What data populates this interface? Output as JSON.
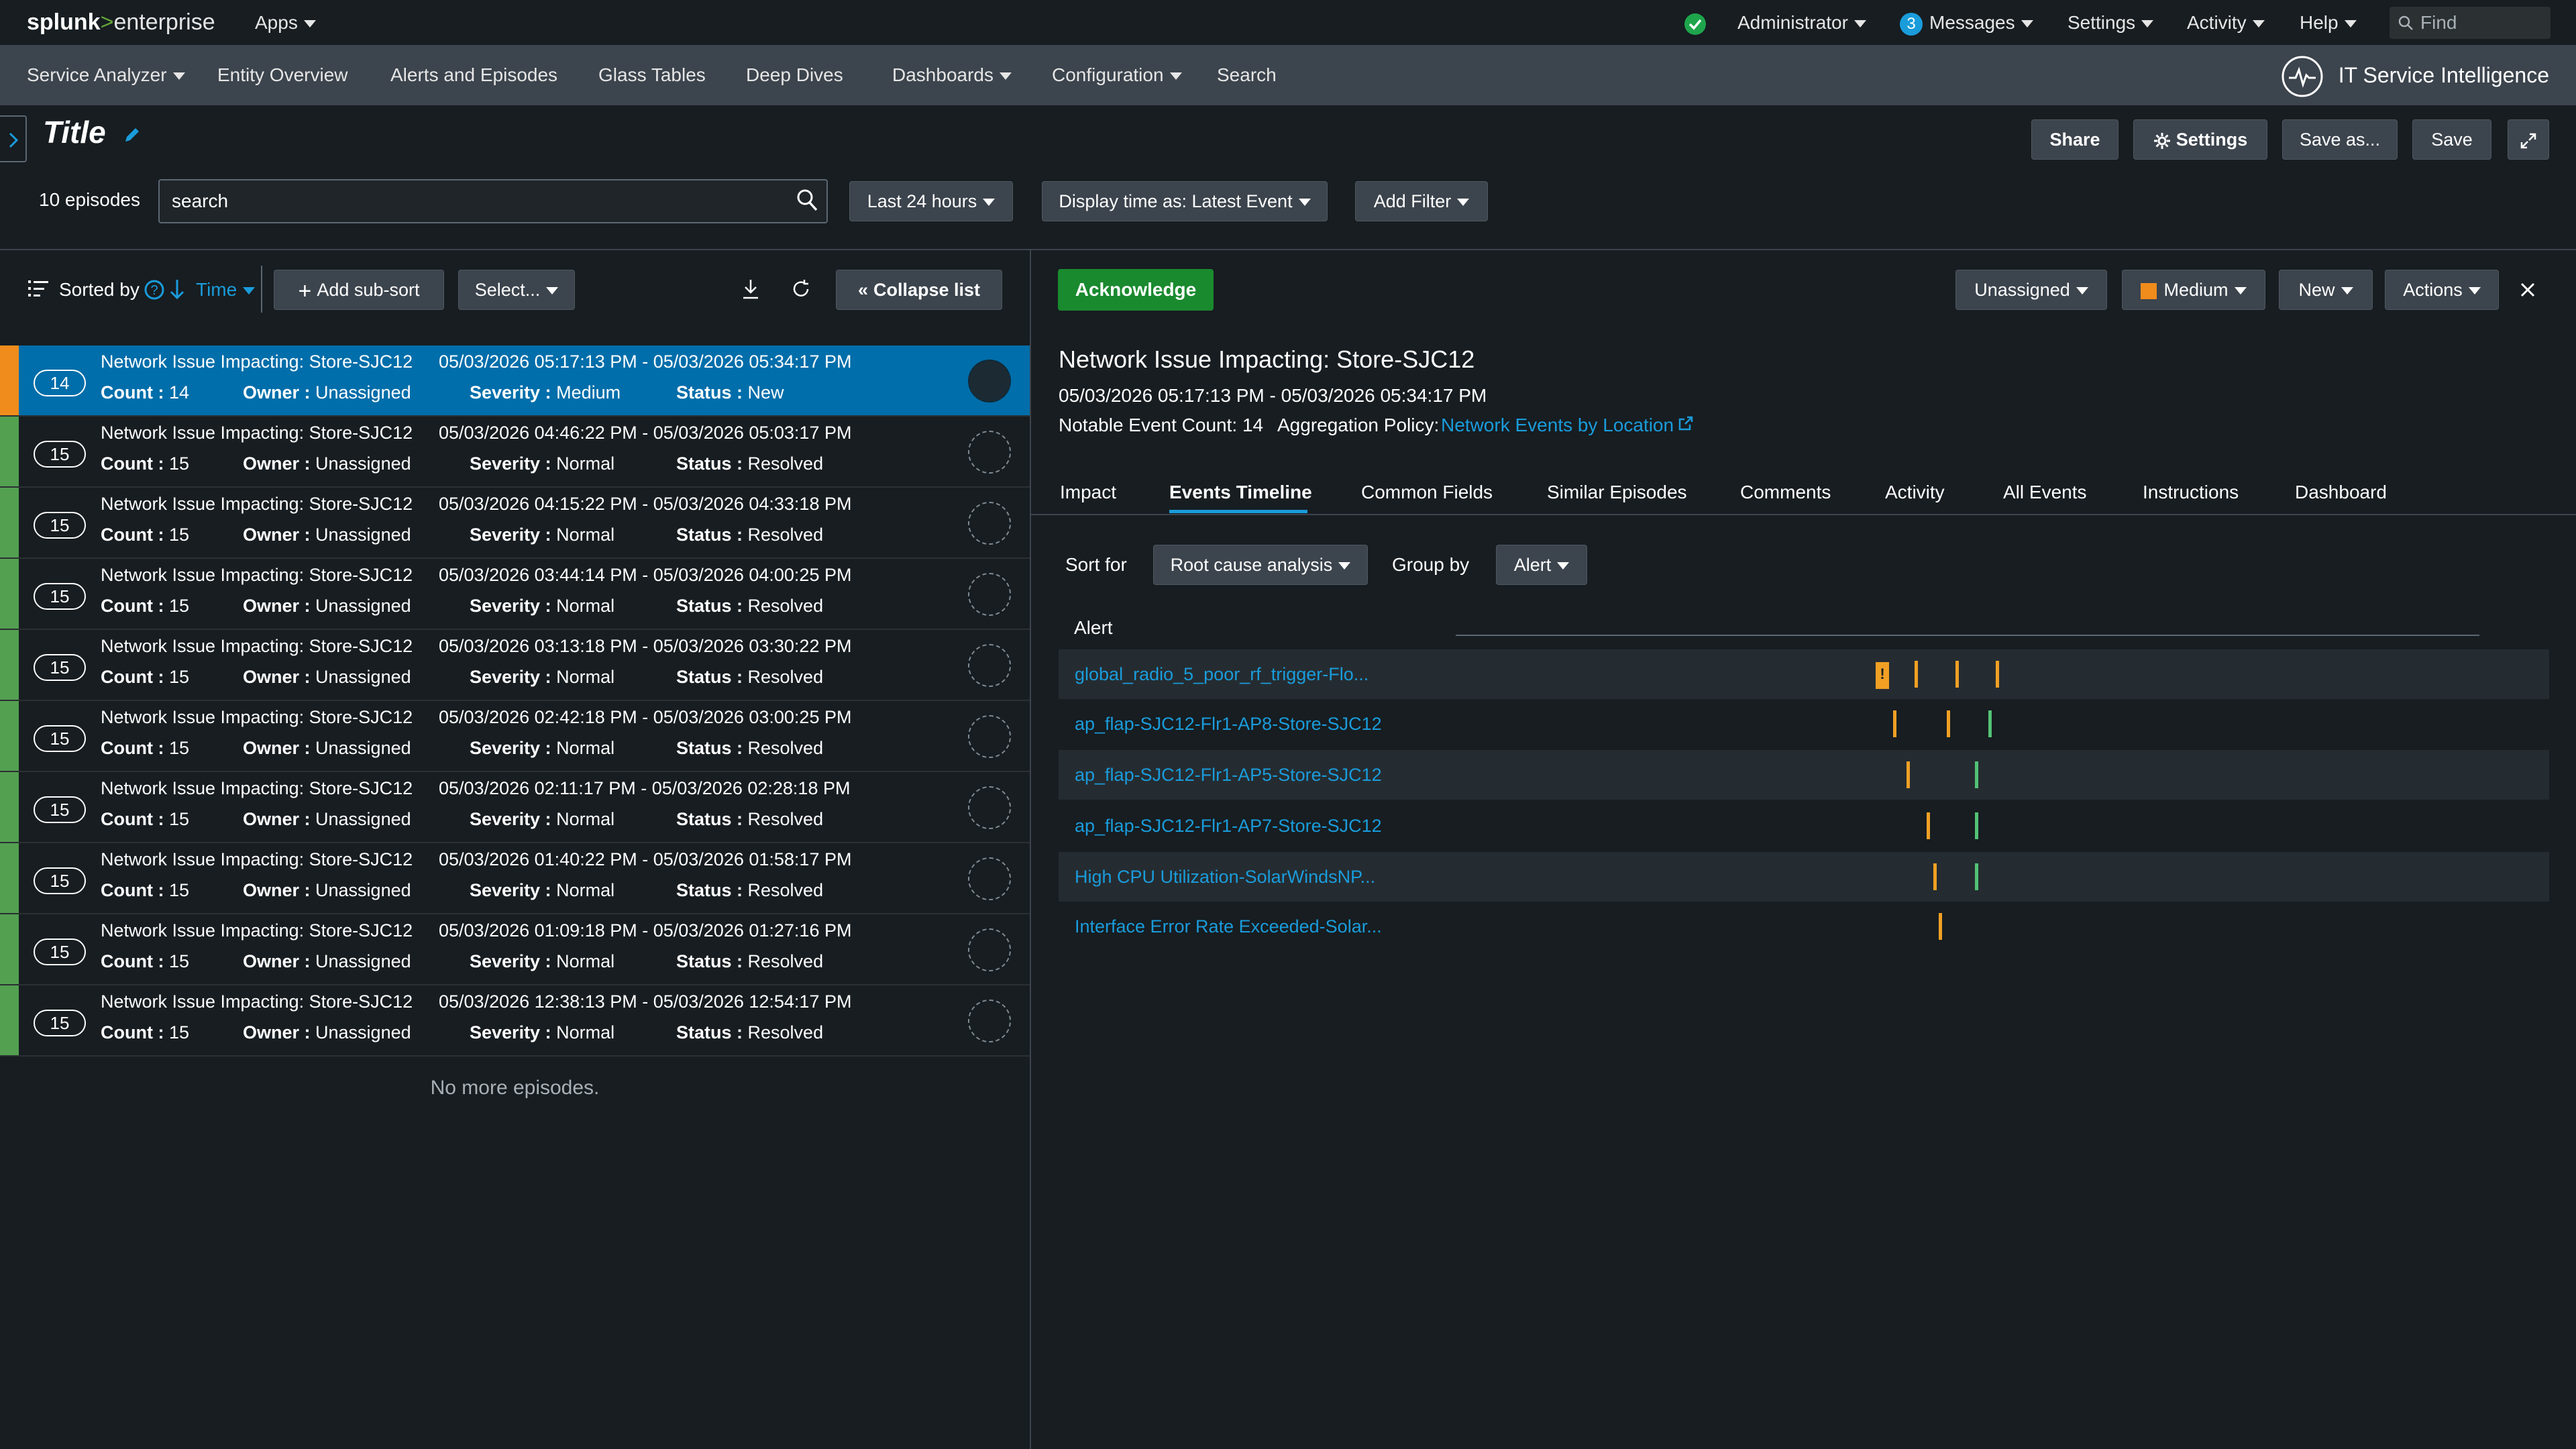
{
  "topbar": {
    "logo_splunk": "splunk",
    "logo_gt": ">",
    "logo_enterprise": "enterprise",
    "apps": "Apps",
    "user": "Administrator",
    "messages_count": "3",
    "messages": "Messages",
    "settings": "Settings",
    "activity": "Activity",
    "help": "Help",
    "find_placeholder": "Find",
    "status_color": "#1ea54c"
  },
  "nav": {
    "items": [
      "Service Analyzer",
      "Entity Overview",
      "Alerts and Episodes",
      "Glass Tables",
      "Deep Dives",
      "Dashboards",
      "Configuration",
      "Search"
    ],
    "app_title": "IT Service Intelligence"
  },
  "header": {
    "title": "Title",
    "share": "Share",
    "settings": "Settings",
    "save_as": "Save as...",
    "save": "Save"
  },
  "filters": {
    "episode_count": "10 episodes",
    "search_value": "search",
    "time_range": "Last 24 hours",
    "display_time": "Display time as: Latest Event",
    "add_filter": "Add Filter"
  },
  "list_controls": {
    "sorted_by": "Sorted by",
    "sort_field": "Time",
    "add_sub_sort": "Add sub-sort",
    "select": "Select...",
    "collapse": "Collapse list"
  },
  "labels": {
    "count": "Count :",
    "owner": "Owner :",
    "severity": "Severity :",
    "status": "Status :"
  },
  "colors": {
    "medium": "#f08c1c",
    "normal": "#53a051",
    "selected_row": "#006eaa",
    "link": "#1a9cdb",
    "accent_orange": "#f1a024",
    "accent_green": "#53c276"
  },
  "episodes": [
    {
      "count": "14",
      "title": "Network Issue Impacting: Store-SJC12",
      "time": "05/03/2026 05:17:13 PM - 05/03/2026 05:34:17 PM",
      "count_value": "14",
      "owner": "Unassigned",
      "severity": "Medium",
      "status": "New"
    },
    {
      "count": "15",
      "title": "Network Issue Impacting: Store-SJC12",
      "time": "05/03/2026 04:46:22 PM - 05/03/2026 05:03:17 PM",
      "count_value": "15",
      "owner": "Unassigned",
      "severity": "Normal",
      "status": "Resolved"
    },
    {
      "count": "15",
      "title": "Network Issue Impacting: Store-SJC12",
      "time": "05/03/2026 04:15:22 PM - 05/03/2026 04:33:18 PM",
      "count_value": "15",
      "owner": "Unassigned",
      "severity": "Normal",
      "status": "Resolved"
    },
    {
      "count": "15",
      "title": "Network Issue Impacting: Store-SJC12",
      "time": "05/03/2026 03:44:14 PM - 05/03/2026 04:00:25 PM",
      "count_value": "15",
      "owner": "Unassigned",
      "severity": "Normal",
      "status": "Resolved"
    },
    {
      "count": "15",
      "title": "Network Issue Impacting: Store-SJC12",
      "time": "05/03/2026 03:13:18 PM - 05/03/2026 03:30:22 PM",
      "count_value": "15",
      "owner": "Unassigned",
      "severity": "Normal",
      "status": "Resolved"
    },
    {
      "count": "15",
      "title": "Network Issue Impacting: Store-SJC12",
      "time": "05/03/2026 02:42:18 PM - 05/03/2026 03:00:25 PM",
      "count_value": "15",
      "owner": "Unassigned",
      "severity": "Normal",
      "status": "Resolved"
    },
    {
      "count": "15",
      "title": "Network Issue Impacting: Store-SJC12",
      "time": "05/03/2026 02:11:17 PM - 05/03/2026 02:28:18 PM",
      "count_value": "15",
      "owner": "Unassigned",
      "severity": "Normal",
      "status": "Resolved"
    },
    {
      "count": "15",
      "title": "Network Issue Impacting: Store-SJC12",
      "time": "05/03/2026 01:40:22 PM - 05/03/2026 01:58:17 PM",
      "count_value": "15",
      "owner": "Unassigned",
      "severity": "Normal",
      "status": "Resolved"
    },
    {
      "count": "15",
      "title": "Network Issue Impacting: Store-SJC12",
      "time": "05/03/2026 01:09:18 PM - 05/03/2026 01:27:16 PM",
      "count_value": "15",
      "owner": "Unassigned",
      "severity": "Normal",
      "status": "Resolved"
    },
    {
      "count": "15",
      "title": "Network Issue Impacting: Store-SJC12",
      "time": "05/03/2026 12:38:13 PM - 05/03/2026 12:54:17 PM",
      "count_value": "15",
      "owner": "Unassigned",
      "severity": "Normal",
      "status": "Resolved"
    }
  ],
  "no_more": "No more episodes.",
  "detail": {
    "acknowledge": "Acknowledge",
    "owner": "Unassigned",
    "severity": "Medium",
    "status": "New",
    "actions": "Actions",
    "title": "Network Issue Impacting: Store-SJC12",
    "time_range": "05/03/2026 05:17:13 PM - 05/03/2026 05:34:17 PM",
    "notable_count": "Notable Event Count: 14",
    "aggregation_label": "Aggregation Policy:",
    "aggregation_policy": "Network Events by Location",
    "tabs": [
      "Impact",
      "Events Timeline",
      "Common Fields",
      "Similar Episodes",
      "Comments",
      "Activity",
      "All Events",
      "Instructions",
      "Dashboard"
    ],
    "sort_for_label": "Sort for",
    "sort_for_value": "Root cause analysis",
    "group_by_label": "Group by",
    "group_by_value": "Alert",
    "alert_header": "Alert",
    "alerts": [
      {
        "name": "global_radio_5_poor_rf_trigger-Flo..."
      },
      {
        "name": "ap_flap-SJC12-Flr1-AP8-Store-SJC12"
      },
      {
        "name": "ap_flap-SJC12-Flr1-AP5-Store-SJC12"
      },
      {
        "name": "ap_flap-SJC12-Flr1-AP7-Store-SJC12"
      },
      {
        "name": "High CPU Utilization-SolarWindsNP..."
      },
      {
        "name": "Interface Error Rate Exceeded-Solar..."
      }
    ]
  }
}
